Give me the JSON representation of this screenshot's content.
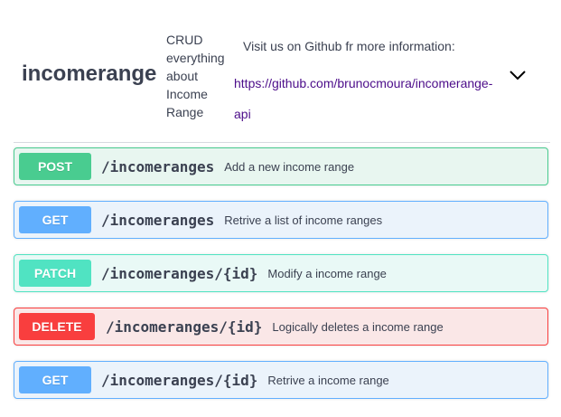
{
  "tag": {
    "name": "incomerange",
    "description_lines": [
      "CRUD",
      "everything",
      "about",
      "Income",
      "Range"
    ],
    "external_docs_text": "Visit us on Github fr more information:",
    "external_docs_url_lines": [
      "https://github.com/brunocmoura/incomerange-",
      "api"
    ],
    "collapse_icon": "chevron-down-icon"
  },
  "operations": [
    {
      "method": "POST",
      "path": "/incomeranges",
      "summary": "Add a new income range",
      "color": "#49cc90"
    },
    {
      "method": "GET",
      "path": "/incomeranges",
      "summary": "Retrive a list of income ranges",
      "color": "#61affe"
    },
    {
      "method": "PATCH",
      "path": "/incomeranges/{id}",
      "summary": "Modify a income range",
      "color": "#50e3c2"
    },
    {
      "method": "DELETE",
      "path": "/incomeranges/{id}",
      "summary": "Logically deletes a income range",
      "color": "#f93e3e"
    },
    {
      "method": "GET",
      "path": "/incomeranges/{id}",
      "summary": "Retrive a income range",
      "color": "#61affe"
    }
  ]
}
